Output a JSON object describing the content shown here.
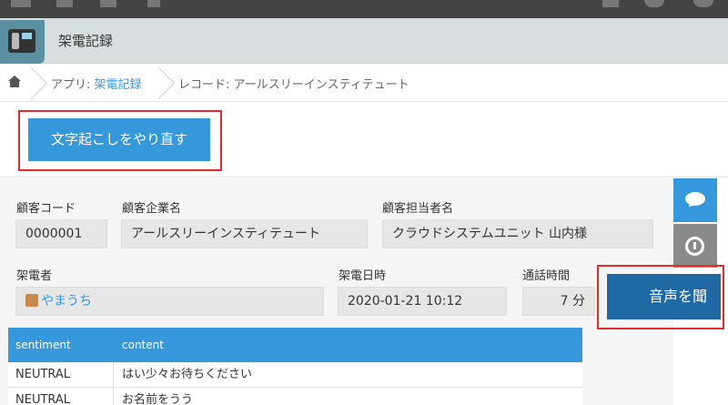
{
  "app": {
    "title": "架電記録"
  },
  "breadcrumb": {
    "app_prefix": "アプリ: ",
    "app_link": "架電記録",
    "record": "レコード: アールスリーインスティテュート"
  },
  "actions": {
    "retranscribe_label": "文字起こしをやり直す",
    "play_audio_label": "音声を聞"
  },
  "fields": {
    "customer_code": {
      "label": "顧客コード",
      "value": "0000001"
    },
    "company_name": {
      "label": "顧客企業名",
      "value": "アールスリーインスティテュート"
    },
    "contact_name": {
      "label": "顧客担当者名",
      "value": "クラウドシステムユニット 山内様"
    },
    "caller": {
      "label": "架電者",
      "value": "やまうち"
    },
    "call_datetime": {
      "label": "架電日時",
      "value": "2020-01-21 10:12"
    },
    "call_duration": {
      "label": "通話時間",
      "value": "7 分"
    }
  },
  "transcript_table": {
    "columns": [
      "sentiment",
      "content"
    ],
    "rows": [
      {
        "sentiment": "NEUTRAL",
        "content": "はい少々お待ちください"
      },
      {
        "sentiment": "NEUTRAL",
        "content": "お名前をうう"
      }
    ]
  },
  "colors": {
    "accent": "#3498db",
    "highlight_frame": "#e52a2a",
    "play_button": "#1f6aa5"
  }
}
